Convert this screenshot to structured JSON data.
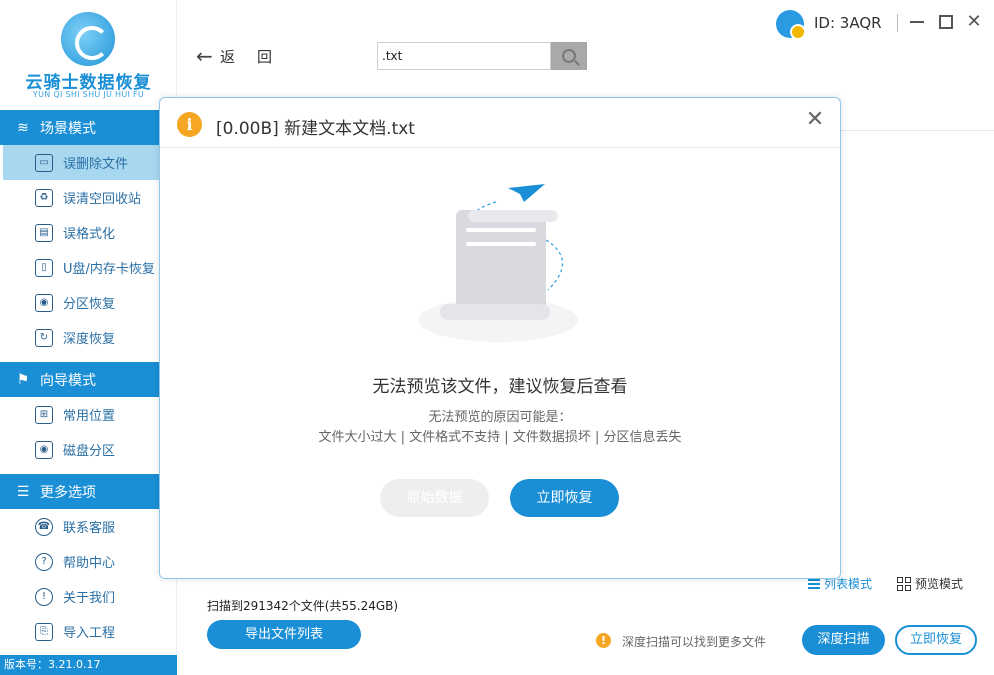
{
  "app": {
    "logo_title": "云骑士数据恢复",
    "logo_subtitle": "YUN QI SHI SHU JU HUI FU",
    "version": "版本号：3.21.0.17"
  },
  "sidebar": {
    "sections": [
      {
        "label": "场景模式",
        "icon": "scene-icon",
        "items": [
          {
            "label": "误删除文件",
            "icon": "deleted-file-icon",
            "active": true
          },
          {
            "label": "误清空回收站",
            "icon": "recycle-bin-icon"
          },
          {
            "label": "误格式化",
            "icon": "format-icon"
          },
          {
            "label": "U盘/内存卡恢复",
            "icon": "usb-drive-icon"
          },
          {
            "label": "分区恢复",
            "icon": "partition-icon"
          },
          {
            "label": "深度恢复",
            "icon": "deep-recover-icon"
          }
        ]
      },
      {
        "label": "向导模式",
        "icon": "guide-icon",
        "items": [
          {
            "label": "常用位置",
            "icon": "common-location-icon"
          },
          {
            "label": "磁盘分区",
            "icon": "disk-partition-icon"
          }
        ]
      },
      {
        "label": "更多选项",
        "icon": "menu-icon",
        "items": [
          {
            "label": "联系客服",
            "icon": "support-icon"
          },
          {
            "label": "帮助中心",
            "icon": "help-icon"
          },
          {
            "label": "关于我们",
            "icon": "about-icon"
          },
          {
            "label": "导入工程",
            "icon": "import-icon"
          }
        ]
      }
    ]
  },
  "toolbar": {
    "back_label": "返回",
    "search_value": ".txt"
  },
  "user": {
    "id_label": "ID: 3AQR"
  },
  "main": {
    "view_list_label": "列表模式",
    "view_preview_label": "预览模式",
    "scan_stats": "扫描到291342个文件(共55.24GB)",
    "export_label": "导出文件列表",
    "hint_text": "深度扫描可以找到更多文件",
    "deep_scan_label": "深度扫描",
    "recover_label": "立即恢复"
  },
  "modal": {
    "title": "[0.00B] 新建文本文档.txt",
    "message": "无法预览该文件，建议恢复后查看",
    "reason_title": "无法预览的原因可能是：",
    "reasons": "文件大小过大 | 文件格式不支持 | 文件数据损坏 | 分区信息丢失",
    "raw_data_label": "原始数据",
    "recover_label": "立即恢复"
  },
  "colors": {
    "brand": "#1a8fd6",
    "active_bg": "#a8d8f0",
    "warning": "#f5a623"
  }
}
